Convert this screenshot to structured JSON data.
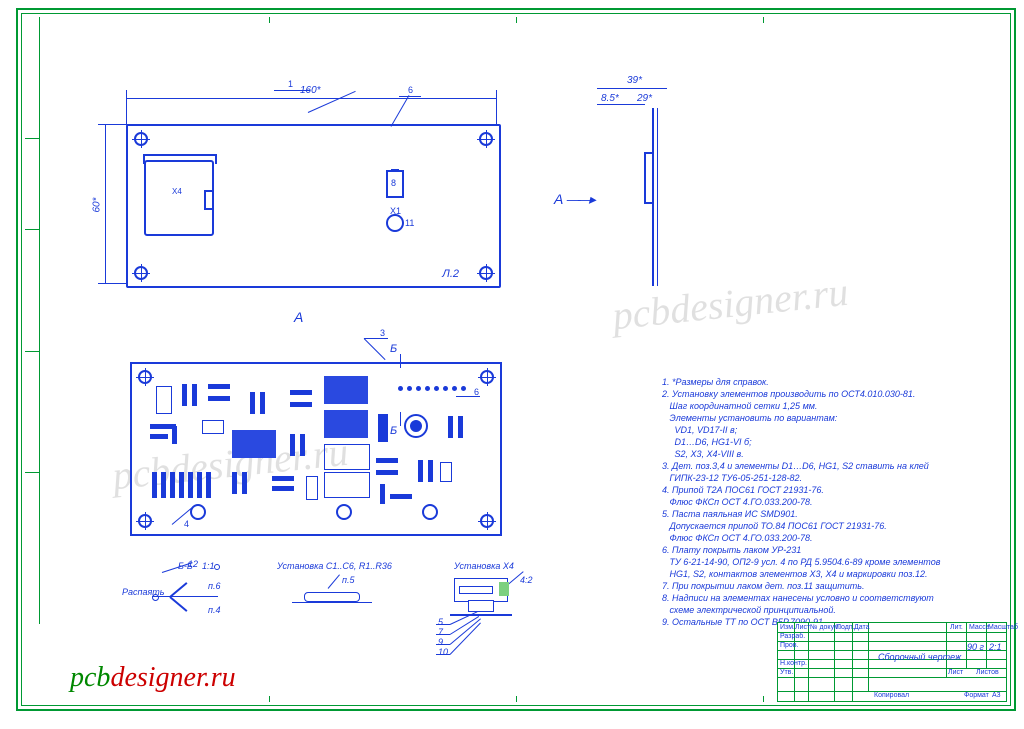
{
  "dims": {
    "width": "160*",
    "height": "60*",
    "side_w": "39*",
    "side_off1": "8.5*",
    "side_off2": "29*"
  },
  "views": {
    "A": "A",
    "B": "Б",
    "A_side": "A",
    "L2": "Л.2"
  },
  "refs": {
    "r1": "1",
    "r6": "6",
    "r8": "8",
    "r3": "3",
    "r4": "4",
    "x1": "X1",
    "x4": "X4"
  },
  "details": {
    "bb_title": "Б-Б",
    "bb_scale": "1:1",
    "bb_note": "Распаять",
    "bb_p4": "п.4",
    "bb_p6": "п.6",
    "bb_p12": "12",
    "d2_title": "Установка С1..С6, R1..R36",
    "d2_p5": "п.5",
    "d3_title": "Установка X4",
    "d3_scale": "4:2",
    "d3_5": "5",
    "d3_7": "7",
    "d3_9": "9",
    "d3_10": "10"
  },
  "notes": [
    "1. *Размеры для справок.",
    "2. Установку элементов производить по ОСТ4.010.030-81.",
    "   Шаг координатной сетки 1,25 мм.",
    "   Элементы установить по вариантам:",
    "     VD1, VD17-II в;",
    "     D1…D6, HG1-VI б;",
    "     S2, X3, X4-VIII в.",
    "3. Дет. поз.3,4 и элементы D1…D6, HG1, S2 ставить на клей",
    "   ГИПК-23-12 ТУ6-05-251-128-82.",
    "4. Припой Т2А ПОС61 ГОСТ 21931-76.",
    "   Флюс ФКСп ОСТ 4.ГО.033.200-78.",
    "5. Паста паяльная ИС SMD901.",
    "   Допускается припой ТО.84 ПОС61 ГОСТ 21931-76.",
    "   Флюс ФКСп ОСТ 4.ГО.033.200-78.",
    "6. Плату покрыть лаком УР-231",
    "   ТУ 6-21-14-90, ОП2-9 усл. 4 по РД 5.9504.6-89 кроме элементов",
    "   HG1, S2, контактов элементов X3, X4 и маркировки поз.12.",
    "7. При покрытии лаком дет. поз.11 защитить.",
    "8. Надписи на элементах нанесены условно и соответствуют",
    "   схеме электрической принципиальной.",
    "9. Остальные ТТ по ОСТ В5Р.7090-91."
  ],
  "title_block": {
    "title": "Сборочный чертеж",
    "mass": "90 г",
    "scale": "2:1",
    "sheet": "Лист",
    "sheet_of": "Листов",
    "copied": "Копировал",
    "format": "Формат",
    "a3": "A3",
    "hd_lit": "Лит.",
    "hd_mass": "Масса",
    "hd_scale": "Масштаб",
    "row_izm": "Изм.",
    "row_list": "Лист",
    "row_doc": "№ докум.",
    "row_sign": "Подп.",
    "row_date": "Дата",
    "roles": [
      "Разраб.",
      "Пров.",
      "",
      "Н.контр.",
      "Утв."
    ]
  },
  "watermark": "pcbdesigner.ru",
  "logo": {
    "a": "pcb",
    "b": "designer.ru"
  }
}
